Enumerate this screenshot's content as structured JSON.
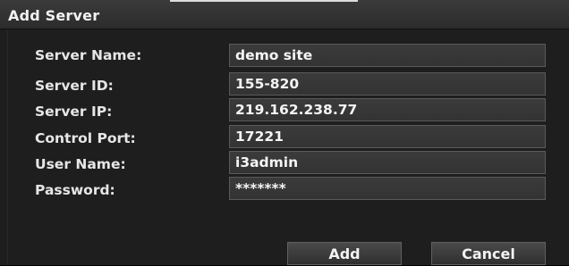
{
  "dialog": {
    "title": "Add Server"
  },
  "fields": [
    {
      "label": "Server Name:",
      "value": "demo site"
    },
    {
      "label": "Server ID:",
      "value": "155-820"
    },
    {
      "label": "Server IP:",
      "value": "219.162.238.77"
    },
    {
      "label": "Control Port:",
      "value": "17221"
    },
    {
      "label": "User Name:",
      "value": "i3admin"
    },
    {
      "label": "Password:",
      "value": "*******"
    }
  ],
  "buttons": {
    "add_label": "Add",
    "cancel_label": "Cancel"
  },
  "colors": {
    "background": "#1e1e1e",
    "titlebar": "#2c2c2c",
    "input_bg": "#353535",
    "input_border": "#5a5a5a",
    "text": "#e6e6e6"
  }
}
